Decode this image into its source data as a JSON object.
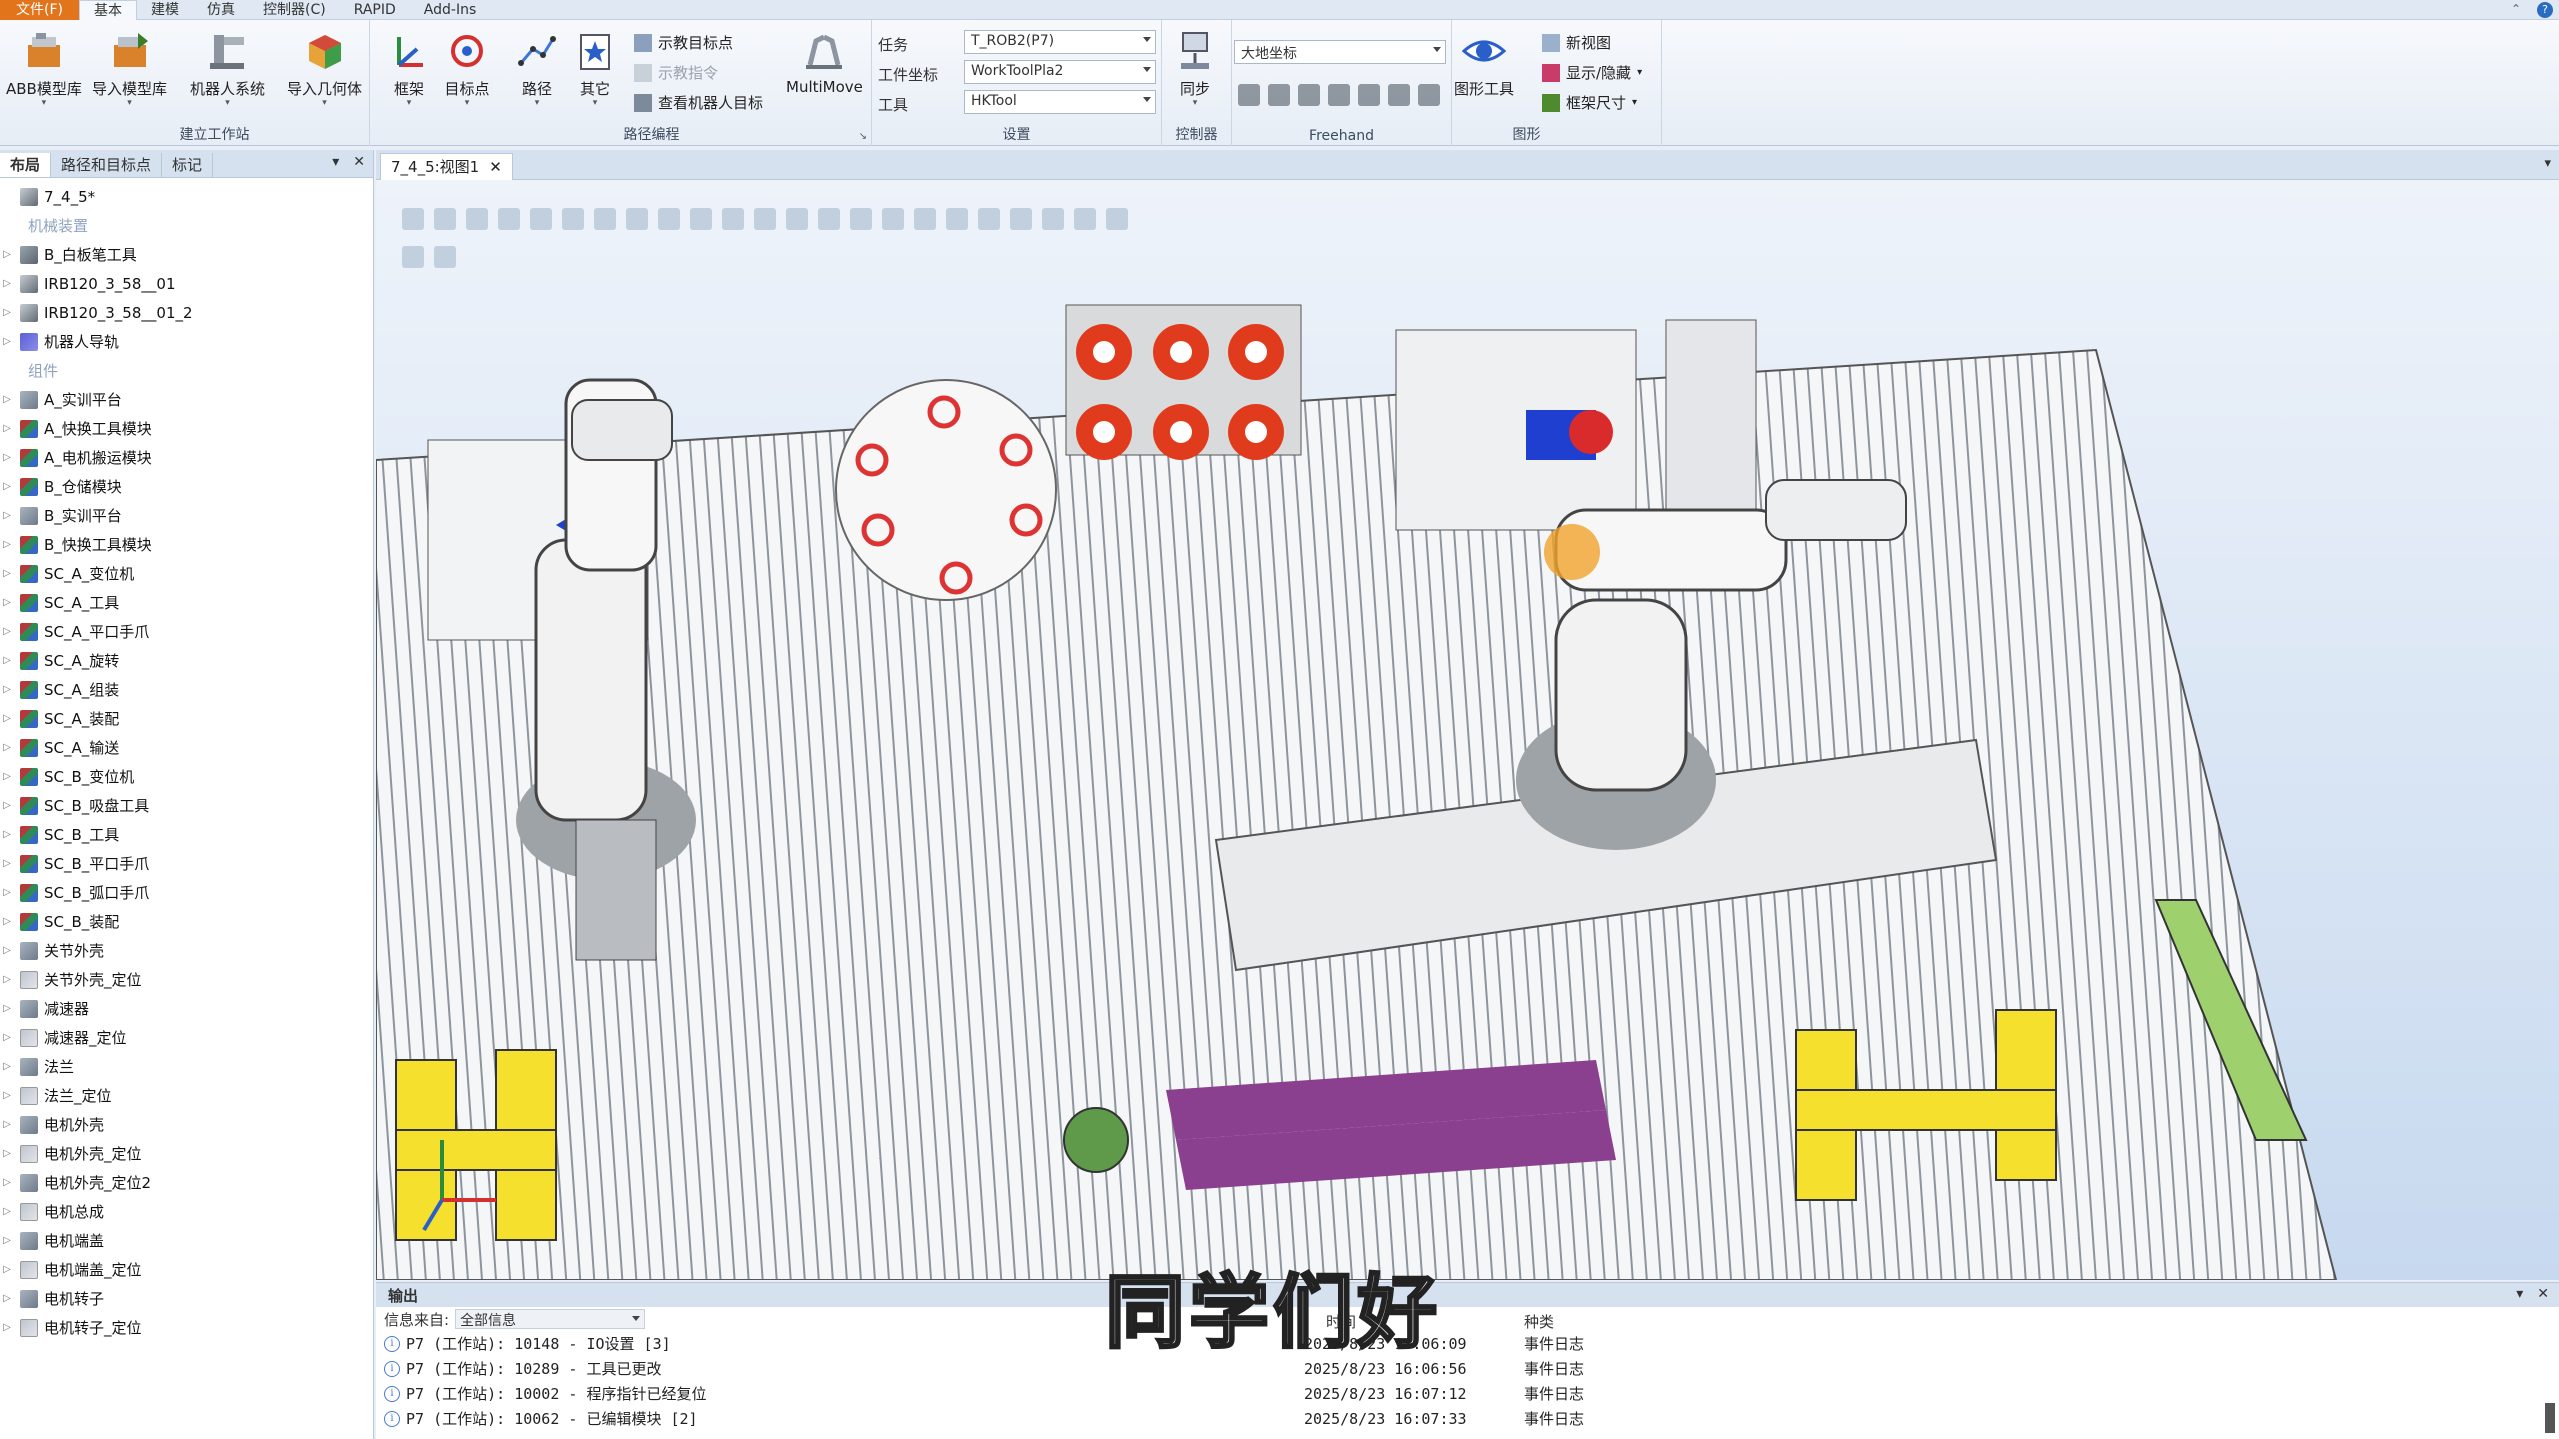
{
  "menu": {
    "file": "文件(F)",
    "tabs": [
      "基本",
      "建模",
      "仿真",
      "控制器(C)",
      "RAPID",
      "Add-Ins"
    ]
  },
  "ribbon": {
    "group1": {
      "title": "建立工作站",
      "buttons": [
        "ABB模型库",
        "导入模型库",
        "机器人系统",
        "导入几何体",
        "框架"
      ]
    },
    "group2": {
      "title": "路径编程",
      "buttons": [
        "目标点",
        "路径",
        "其它"
      ],
      "small": [
        "示教目标点",
        "示教指令",
        "查看机器人目标"
      ],
      "multimove": "MultiMove"
    },
    "group3": {
      "title": "设置",
      "labels": [
        "任务",
        "工件坐标",
        "工具"
      ],
      "values": [
        "T_ROB2(P7)",
        "WorkToolPla2",
        "HKTool"
      ]
    },
    "group4": {
      "title": "控制器",
      "button": "同步"
    },
    "group5": {
      "title": "Freehand",
      "combo": "大地坐标"
    },
    "group6": {
      "title": "图形",
      "button": "图形工具",
      "small": [
        "新视图",
        "显示/隐藏",
        "框架尺寸"
      ]
    }
  },
  "panel": {
    "tabs": [
      "布局",
      "路径和目标点",
      "标记"
    ],
    "root": "7_4_5*",
    "section1": "机械装置",
    "mechanisms": [
      "B_白板笔工具",
      "IRB120_3_58__01",
      "IRB120_3_58__01_2",
      "机器人导轨"
    ],
    "section2": "组件",
    "components": [
      "A_实训平台",
      "A_快换工具模块",
      "A_电机搬运模块",
      "B_仓储模块",
      "B_实训平台",
      "B_快换工具模块",
      "SC_A_变位机",
      "SC_A_工具",
      "SC_A_平口手爪",
      "SC_A_旋转",
      "SC_A_组装",
      "SC_A_装配",
      "SC_A_输送",
      "SC_B_变位机",
      "SC_B_吸盘工具",
      "SC_B_工具",
      "SC_B_平口手爪",
      "SC_B_弧口手爪",
      "SC_B_装配",
      "关节外壳",
      "关节外壳_定位",
      "减速器",
      "减速器_定位",
      "法兰",
      "法兰_定位",
      "电机外壳",
      "电机外壳_定位",
      "电机外壳_定位2",
      "电机总成",
      "电机端盖",
      "电机端盖_定位",
      "电机转子",
      "电机转子_定位"
    ]
  },
  "doc": {
    "tab": "7_4_5:视图1"
  },
  "output": {
    "title": "输出",
    "filter_label": "信息来自:",
    "filter_value": "全部信息",
    "col_time": "时间",
    "col_type": "种类",
    "rows": [
      {
        "msg": "P7 (工作站): 10148 - IO设置 [3]",
        "time": "2025/8/23 16:06:09",
        "type": "事件日志"
      },
      {
        "msg": "P7 (工作站): 10289 - 工具已更改",
        "time": "2025/8/23 16:06:56",
        "type": "事件日志"
      },
      {
        "msg": "P7 (工作站): 10002 - 程序指针已经复位",
        "time": "2025/8/23 16:07:12",
        "type": "事件日志"
      },
      {
        "msg": "P7 (工作站): 10062 - 已编辑模块 [2]",
        "time": "2025/8/23 16:07:33",
        "type": "事件日志"
      }
    ]
  },
  "subtitle": "同学们好"
}
